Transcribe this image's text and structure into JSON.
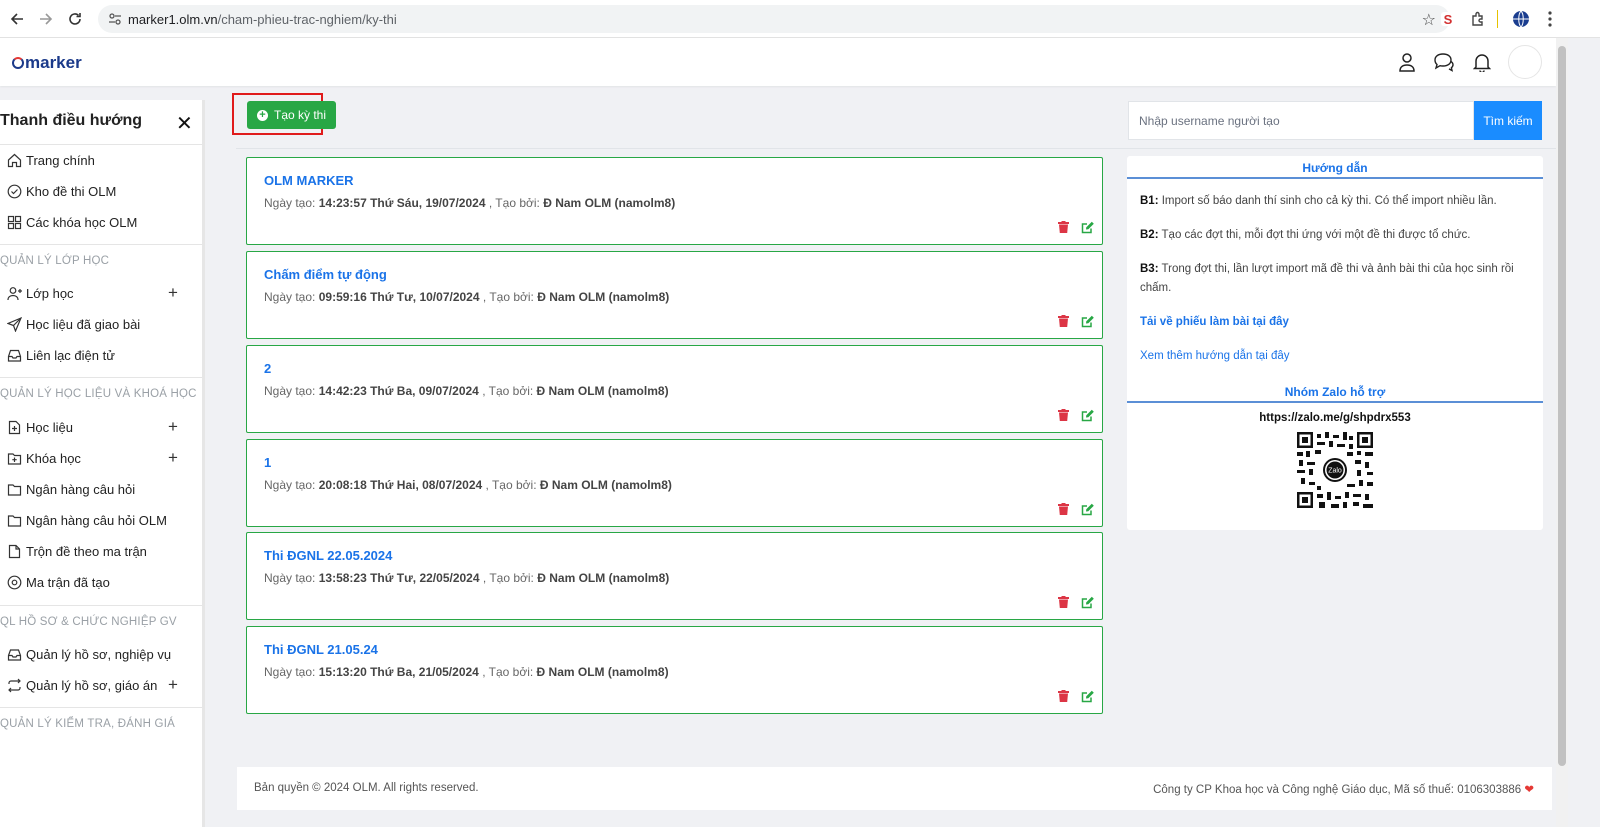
{
  "browser": {
    "url_host": "marker1.olm.vn",
    "url_path": "/cham-phieu-trac-nghiem/ky-thi"
  },
  "app": {
    "logo_text": "marker"
  },
  "sidebar": {
    "title": "Thanh điều hướng",
    "items": [
      {
        "label": "Trang chính"
      },
      {
        "label": "Kho đề thi OLM"
      },
      {
        "label": "Các khóa học OLM"
      }
    ],
    "sections": [
      {
        "title": "QUẢN LÝ LỚP HỌC",
        "items": [
          {
            "label": "Lớp học"
          },
          {
            "label": "Học liệu đã giao bài"
          },
          {
            "label": "Liên lạc điện tử"
          }
        ]
      },
      {
        "title": "QUẢN LÝ HỌC LIỆU VÀ KHOÁ HỌC",
        "items": [
          {
            "label": "Học liệu"
          },
          {
            "label": "Khóa học"
          },
          {
            "label": "Ngân hàng câu hỏi"
          },
          {
            "label": "Ngân hàng câu hỏi OLM"
          },
          {
            "label": "Trộn đề theo ma trận"
          },
          {
            "label": "Ma trận đã tạo"
          }
        ]
      },
      {
        "title": "QL HỒ SƠ & CHỨC NGHIỆP GV",
        "items": [
          {
            "label": "Quản lý hồ sơ, nghiệp vụ"
          },
          {
            "label": "Quản lý hồ sơ, giáo án"
          }
        ]
      },
      {
        "title": "QUẢN LÝ KIỂM TRA, ĐÁNH GIÁ",
        "items": []
      }
    ]
  },
  "toolbar": {
    "create_label": "Tạo kỳ thi",
    "search_placeholder": "Nhập username người tạo",
    "search_label": "Tìm kiếm"
  },
  "labels": {
    "created": "Ngày tạo:",
    "by": ", Tạo bởi:"
  },
  "exams": [
    {
      "title": "OLM MARKER",
      "created": "14:23:57 Thứ Sáu, 19/07/2024",
      "author": "Đ Nam OLM (namolm8)"
    },
    {
      "title": "Chấm điểm tự động",
      "created": "09:59:16 Thứ Tư, 10/07/2024",
      "author": "Đ Nam OLM (namolm8)"
    },
    {
      "title": "2",
      "created": "14:42:23 Thứ Ba, 09/07/2024",
      "author": "Đ Nam OLM (namolm8)"
    },
    {
      "title": "1",
      "created": "20:08:18 Thứ Hai, 08/07/2024",
      "author": "Đ Nam OLM (namolm8)"
    },
    {
      "title": "Thi ĐGNL 22.05.2024",
      "created": "13:58:23 Thứ Tư, 22/05/2024",
      "author": "Đ Nam OLM (namolm8)"
    },
    {
      "title": "Thi ĐGNL 21.05.24",
      "created": "15:13:20 Thứ Ba, 21/05/2024",
      "author": "Đ Nam OLM (namolm8)"
    }
  ],
  "guide": {
    "title": "Hướng dẫn",
    "steps": [
      {
        "key": "B1:",
        "text": "Import số báo danh thí sinh cho cả kỳ thi. Có thể import nhiều lần."
      },
      {
        "key": "B2:",
        "text": "Tạo các đợt thi, mỗi đợt thi ứng với một đề thi được tổ chức."
      },
      {
        "key": "B3:",
        "text": "Trong đợt thi, lần lượt import mã đề thi và ảnh bài thi của học sinh rồi chấm."
      }
    ],
    "download_link": "Tải về phiếu làm bài tại đây",
    "more_link": "Xem thêm hướng dẫn tại đây",
    "zalo_title": "Nhóm Zalo hỗ trợ",
    "zalo_url": "https://zalo.me/g/shpdrx553",
    "qr_badge": "Zalo"
  },
  "footer": {
    "copyright": "Bản quyền © 2024 OLM. All rights reserved.",
    "company": "Công ty CP Khoa học và Công nghệ Giáo dục, Mã số thuế: 0106303886"
  },
  "colors": {
    "accent_green": "#28a745",
    "link_blue": "#1a73e8",
    "search_blue": "#1a8cff",
    "highlight_red": "#e01b1b"
  }
}
